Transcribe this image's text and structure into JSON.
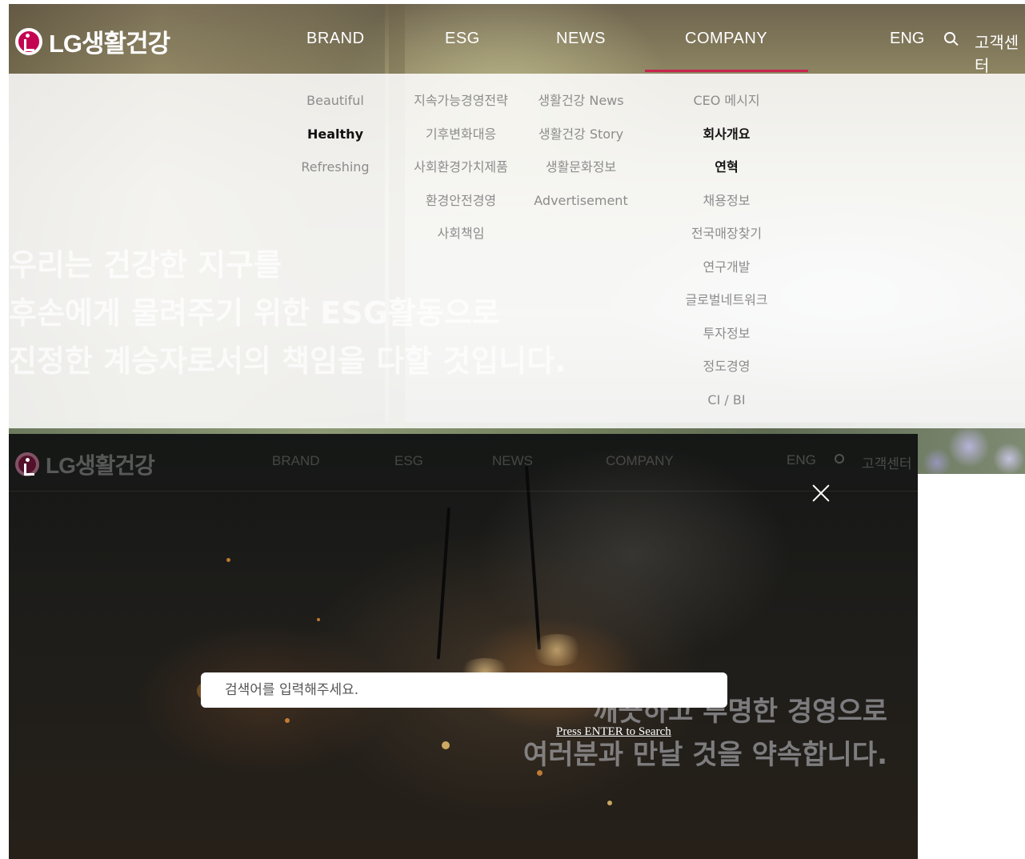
{
  "header": {
    "logo_text": "LG생활건강",
    "nav": [
      "BRAND",
      "ESG",
      "NEWS",
      "COMPANY"
    ],
    "active_nav": "COMPANY",
    "lang": "ENG",
    "customer_center": "고객센터",
    "customer_center_dim": "고객센터"
  },
  "mega_menu": {
    "brand": [
      "Beautiful",
      "Healthy",
      "Refreshing"
    ],
    "esg": [
      "지속가능경영전략",
      "기후변화대응",
      "사회환경가치제품",
      "환경안전경영",
      "사회책임"
    ],
    "news": [
      "생활건강 News",
      "생활건강 Story",
      "생활문화정보",
      "Advertisement"
    ],
    "company": [
      "CEO 메시지",
      "회사개요",
      "연혁",
      "채용정보",
      "전국매장찾기",
      "연구개발",
      "글로벌네트워크",
      "투자정보",
      "정도경영",
      "CI / BI"
    ]
  },
  "hero": {
    "line1": "우리는 건강한 지구를",
    "line2": "후손에게 물려주기 위한 ESG활동으로",
    "line3": "진정한 계승자로서의 책임을 다할 것입니다."
  },
  "search_overlay": {
    "placeholder": "검색어를 입력해주세요.",
    "hint": "Press ENTER to Search",
    "bg_line1": "깨끗하고 투명한 경영으로",
    "bg_line2": "여러분과 만날 것을 약속합니다."
  },
  "colors": {
    "brand": "#c40451",
    "active_bar": "#c7254e"
  },
  "icons": [
    "logo-mark-icon",
    "search-icon",
    "close-icon"
  ]
}
